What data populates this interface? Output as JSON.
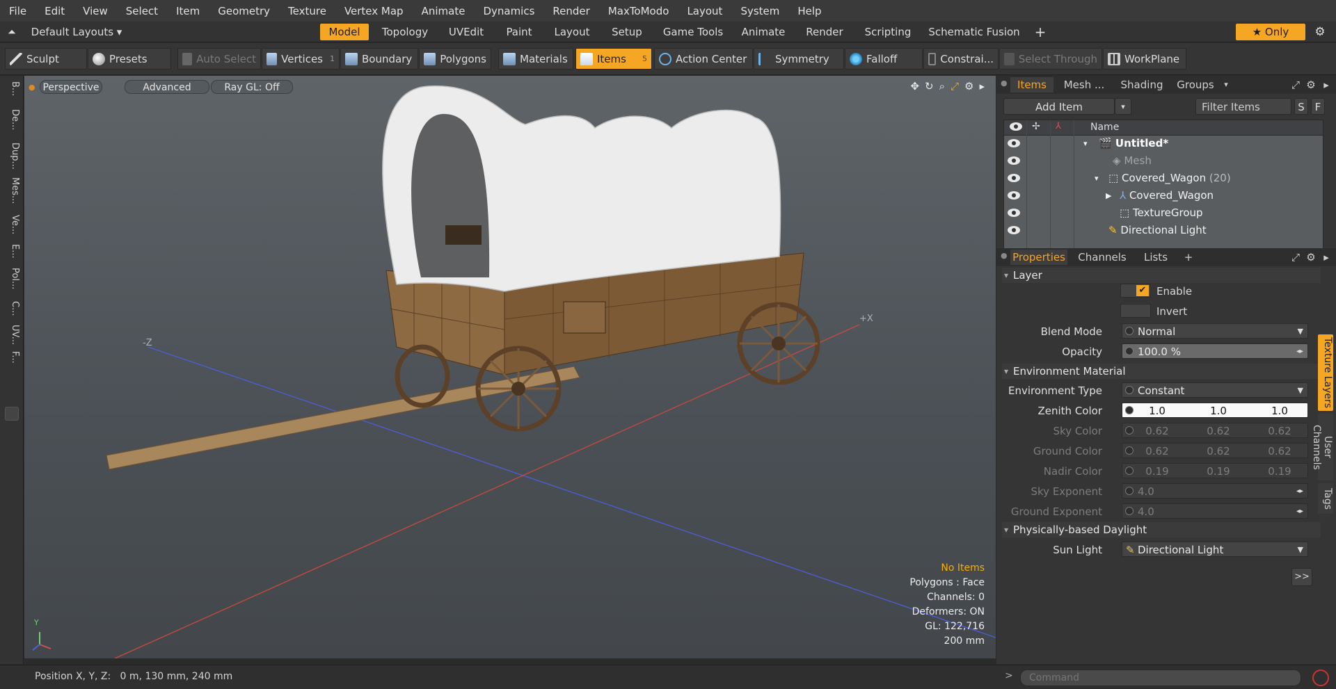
{
  "menu": [
    "File",
    "Edit",
    "View",
    "Select",
    "Item",
    "Geometry",
    "Texture",
    "Vertex Map",
    "Animate",
    "Dynamics",
    "Render",
    "MaxToModo",
    "Layout",
    "System",
    "Help"
  ],
  "layout_selector": "Default Layouts",
  "layout_tabs": [
    "Model",
    "Topology",
    "UVEdit",
    "Paint",
    "Layout",
    "Setup",
    "Game Tools",
    "Animate",
    "Render",
    "Scripting",
    "Schematic Fusion"
  ],
  "layout_active": "Model",
  "only_label": "Only",
  "toolbar": {
    "sculpt": "Sculpt",
    "presets": "Presets",
    "auto_select": "Auto Select",
    "vertices": "Vertices",
    "vertices_count": "1",
    "boundary": "Boundary",
    "polygons": "Polygons",
    "materials": "Materials",
    "items": "Items",
    "items_count": "5",
    "action_center": "Action Center",
    "symmetry": "Symmetry",
    "falloff": "Falloff",
    "constraints": "Constrai...",
    "select_through": "Select Through",
    "workplane": "WorkPlane"
  },
  "left_tabs": [
    "B...",
    "De...",
    "Dup...",
    "Mes...",
    "Ve...",
    "E...",
    "Pol...",
    "C...",
    "UV...",
    "F..."
  ],
  "viewport": {
    "perspective": "Perspective",
    "advanced": "Advanced",
    "ray_gl": "Ray GL: Off",
    "axis_minus_z": "-Z",
    "axis_plus_x": "+X",
    "axis_y": "Y",
    "hud": {
      "no_items": "No Items",
      "polygons": "Polygons : Face",
      "channels": "Channels: 0",
      "deformers": "Deformers: ON",
      "gl": "GL: 122,716",
      "scale": "200 mm"
    }
  },
  "items_panel": {
    "tabs": [
      "Items",
      "Mesh ...",
      "Shading",
      "Groups"
    ],
    "active_tab": "Items",
    "add_item": "Add Item",
    "filter_items": "Filter Items",
    "s_btn": "S",
    "f_btn": "F",
    "name_col": "Name",
    "tree": [
      {
        "label": "Untitled*",
        "suffix": ""
      },
      {
        "label": "Mesh",
        "suffix": ""
      },
      {
        "label": "Covered_Wagon",
        "suffix": "(20)"
      },
      {
        "label": "Covered_Wagon",
        "suffix": ""
      },
      {
        "label": "TextureGroup",
        "suffix": ""
      },
      {
        "label": "Directional Light",
        "suffix": ""
      }
    ]
  },
  "properties_panel": {
    "tabs": [
      "Properties",
      "Channels",
      "Lists",
      "+"
    ],
    "active_tab": "Properties",
    "side_tabs": [
      "Texture Layers",
      "User Channels",
      "Tags"
    ],
    "layer_section": "Layer",
    "enable": "Enable",
    "invert": "Invert",
    "blend_mode_label": "Blend Mode",
    "blend_mode": "Normal",
    "opacity_label": "Opacity",
    "opacity": "100.0 %",
    "env_section": "Environment Material",
    "env_type_label": "Environment Type",
    "env_type": "Constant",
    "zenith_label": "Zenith Color",
    "zenith": [
      "1.0",
      "1.0",
      "1.0"
    ],
    "sky_label": "Sky Color",
    "sky": [
      "0.62",
      "0.62",
      "0.62"
    ],
    "ground_label": "Ground Color",
    "ground": [
      "0.62",
      "0.62",
      "0.62"
    ],
    "nadir_label": "Nadir Color",
    "nadir": [
      "0.19",
      "0.19",
      "0.19"
    ],
    "sky_exp_label": "Sky Exponent",
    "sky_exp": "4.0",
    "ground_exp_label": "Ground Exponent",
    "ground_exp": "4.0",
    "daylight_section": "Physically-based Daylight",
    "sun_light_label": "Sun Light",
    "sun_light": "Directional Light",
    "more": ">>"
  },
  "status": {
    "position": "Position X, Y, Z:   0 m, 130 mm, 240 mm",
    "command_placeholder": "Command"
  },
  "colors": {
    "accent": "#f5a623",
    "panel": "#353535",
    "viewport": "#4f555a"
  }
}
